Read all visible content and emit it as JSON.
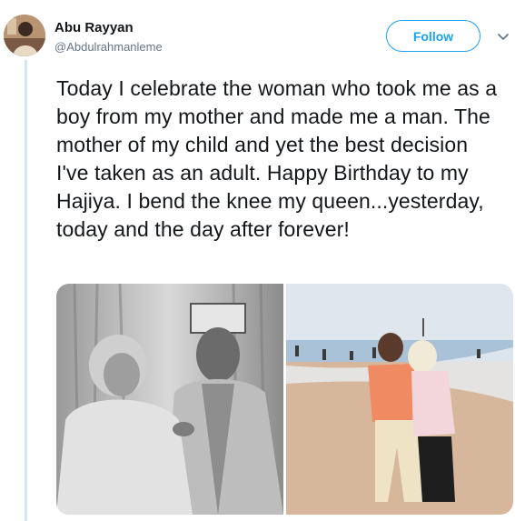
{
  "author": {
    "name": "Abu Rayyan",
    "handle": "@Abdulrahmanleme"
  },
  "actions": {
    "follow_label": "Follow"
  },
  "tweet": {
    "text": "Today I celebrate the woman who took me as a boy from my mother and made me a man. The mother of my child and yet the best decision I've taken as an adult. Happy Birthday to my Hajiya. I bend the knee my queen...yesterday, today and the day after forever!"
  },
  "colors": {
    "accent": "#1da1f2",
    "handle": "#657786",
    "thread_line": "#cfe8f8"
  },
  "icons": {
    "caret": "chevron-down-icon"
  }
}
